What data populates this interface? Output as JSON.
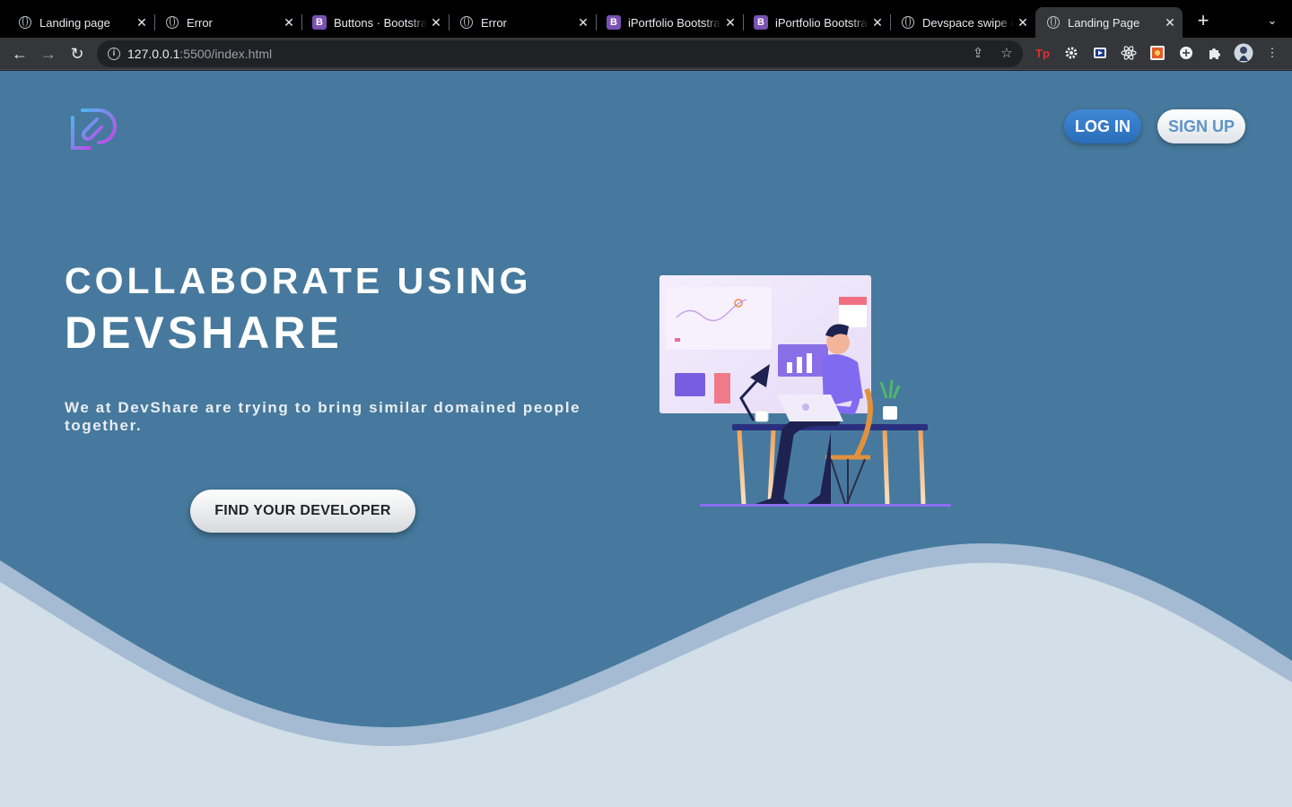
{
  "browser": {
    "tabs": [
      {
        "title": "Landing page",
        "favicon": "globe-icon"
      },
      {
        "title": "Error",
        "favicon": "globe-icon"
      },
      {
        "title": "Buttons · Bootstrap",
        "favicon": "bootstrap-icon"
      },
      {
        "title": "Error",
        "favicon": "globe-icon"
      },
      {
        "title": "iPortfolio Bootstrap",
        "favicon": "bootstrap-icon"
      },
      {
        "title": "iPortfolio Bootstrap",
        "favicon": "bootstrap-icon"
      },
      {
        "title": "Devspace swipe c",
        "favicon": "globe-icon"
      },
      {
        "title": "Landing Page",
        "favicon": "globe-icon",
        "active": true
      }
    ],
    "bootstrap_letter": "B",
    "address": {
      "host": "127.0.0.1",
      "rest": ":5500/index.html"
    }
  },
  "page": {
    "nav": {
      "login_label": "LOG IN",
      "signup_label": "SIGN UP"
    },
    "hero": {
      "title_line1": "COLLABORATE USING",
      "title_line2": "DEVSHARE",
      "subtitle": "We at DevShare are trying to bring similar domained people together.",
      "cta_label": "FIND YOUR DEVELOPER"
    }
  },
  "colors": {
    "page_bg": "#46799d",
    "wave_mid": "#a4bbd3",
    "wave_light": "#d3dfe8",
    "login_btn": "#3f88d6",
    "signup_text": "#5f93c6"
  }
}
